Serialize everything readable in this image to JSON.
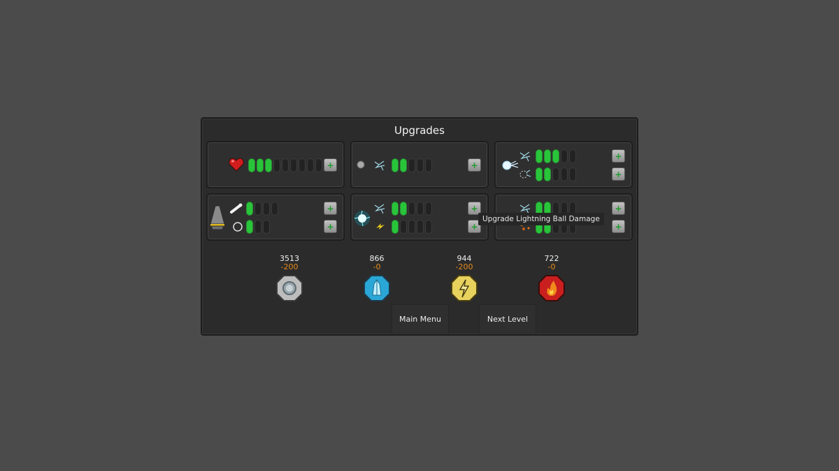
{
  "title": "Upgrades",
  "colors": {
    "bar_on": "#28c53a",
    "bar_off": "#222222",
    "cost": "#e88a1a",
    "background": "#4b4b4b",
    "panel": "#2b2b2b"
  },
  "cards": [
    {
      "icons": [
        "heart-icon"
      ],
      "rows": [
        {
          "icon": "heart-icon",
          "level": 3,
          "max": 9
        }
      ]
    },
    {
      "icons": [
        "stone-ball-icon",
        "lightning-spark-icon"
      ],
      "rows": [
        {
          "icon": "lightning-spark-icon",
          "level": 2,
          "max": 5
        }
      ]
    },
    {
      "icons": [
        "ice-projectile-icon"
      ],
      "rows": [
        {
          "icon": "lightning-spark-icon",
          "level": 3,
          "max": 5
        },
        {
          "icon": "cloud-spark-icon",
          "level": 2,
          "max": 5
        }
      ]
    },
    {
      "icons": [
        "cannon-icon"
      ],
      "rows": [
        {
          "icon": "bone-icon",
          "level": 1,
          "max": 4
        },
        {
          "icon": "ring-icon",
          "level": 1,
          "max": 3
        }
      ]
    },
    {
      "icons": [
        "lightning-ball-icon"
      ],
      "rows": [
        {
          "icon": "lightning-spark-icon",
          "level": 2,
          "max": 5
        },
        {
          "icon": "bolt-icon",
          "level": 1,
          "max": 5
        }
      ]
    },
    {
      "icons": [
        "fire-icon"
      ],
      "rows": [
        {
          "icon": "lightning-spark-icon",
          "level": 2,
          "max": 5
        },
        {
          "icon": "ember-icon",
          "level": 2,
          "max": 5
        }
      ]
    }
  ],
  "tooltip": "Upgrade Lightning Ball Damage",
  "resources": [
    {
      "count": "3513",
      "cost": "-200",
      "icon": "stone-gem-icon",
      "color": "#c9c9c9"
    },
    {
      "count": "866",
      "cost": "-0",
      "icon": "ice-gem-icon",
      "color": "#3bb8e0"
    },
    {
      "count": "944",
      "cost": "-200",
      "icon": "lightning-gem-icon",
      "color": "#e6cf55"
    },
    {
      "count": "722",
      "cost": "-0",
      "icon": "fire-gem-icon",
      "color": "#d42323"
    }
  ],
  "buttons": {
    "main_menu": "Main Menu",
    "next_level": "Next Level"
  }
}
